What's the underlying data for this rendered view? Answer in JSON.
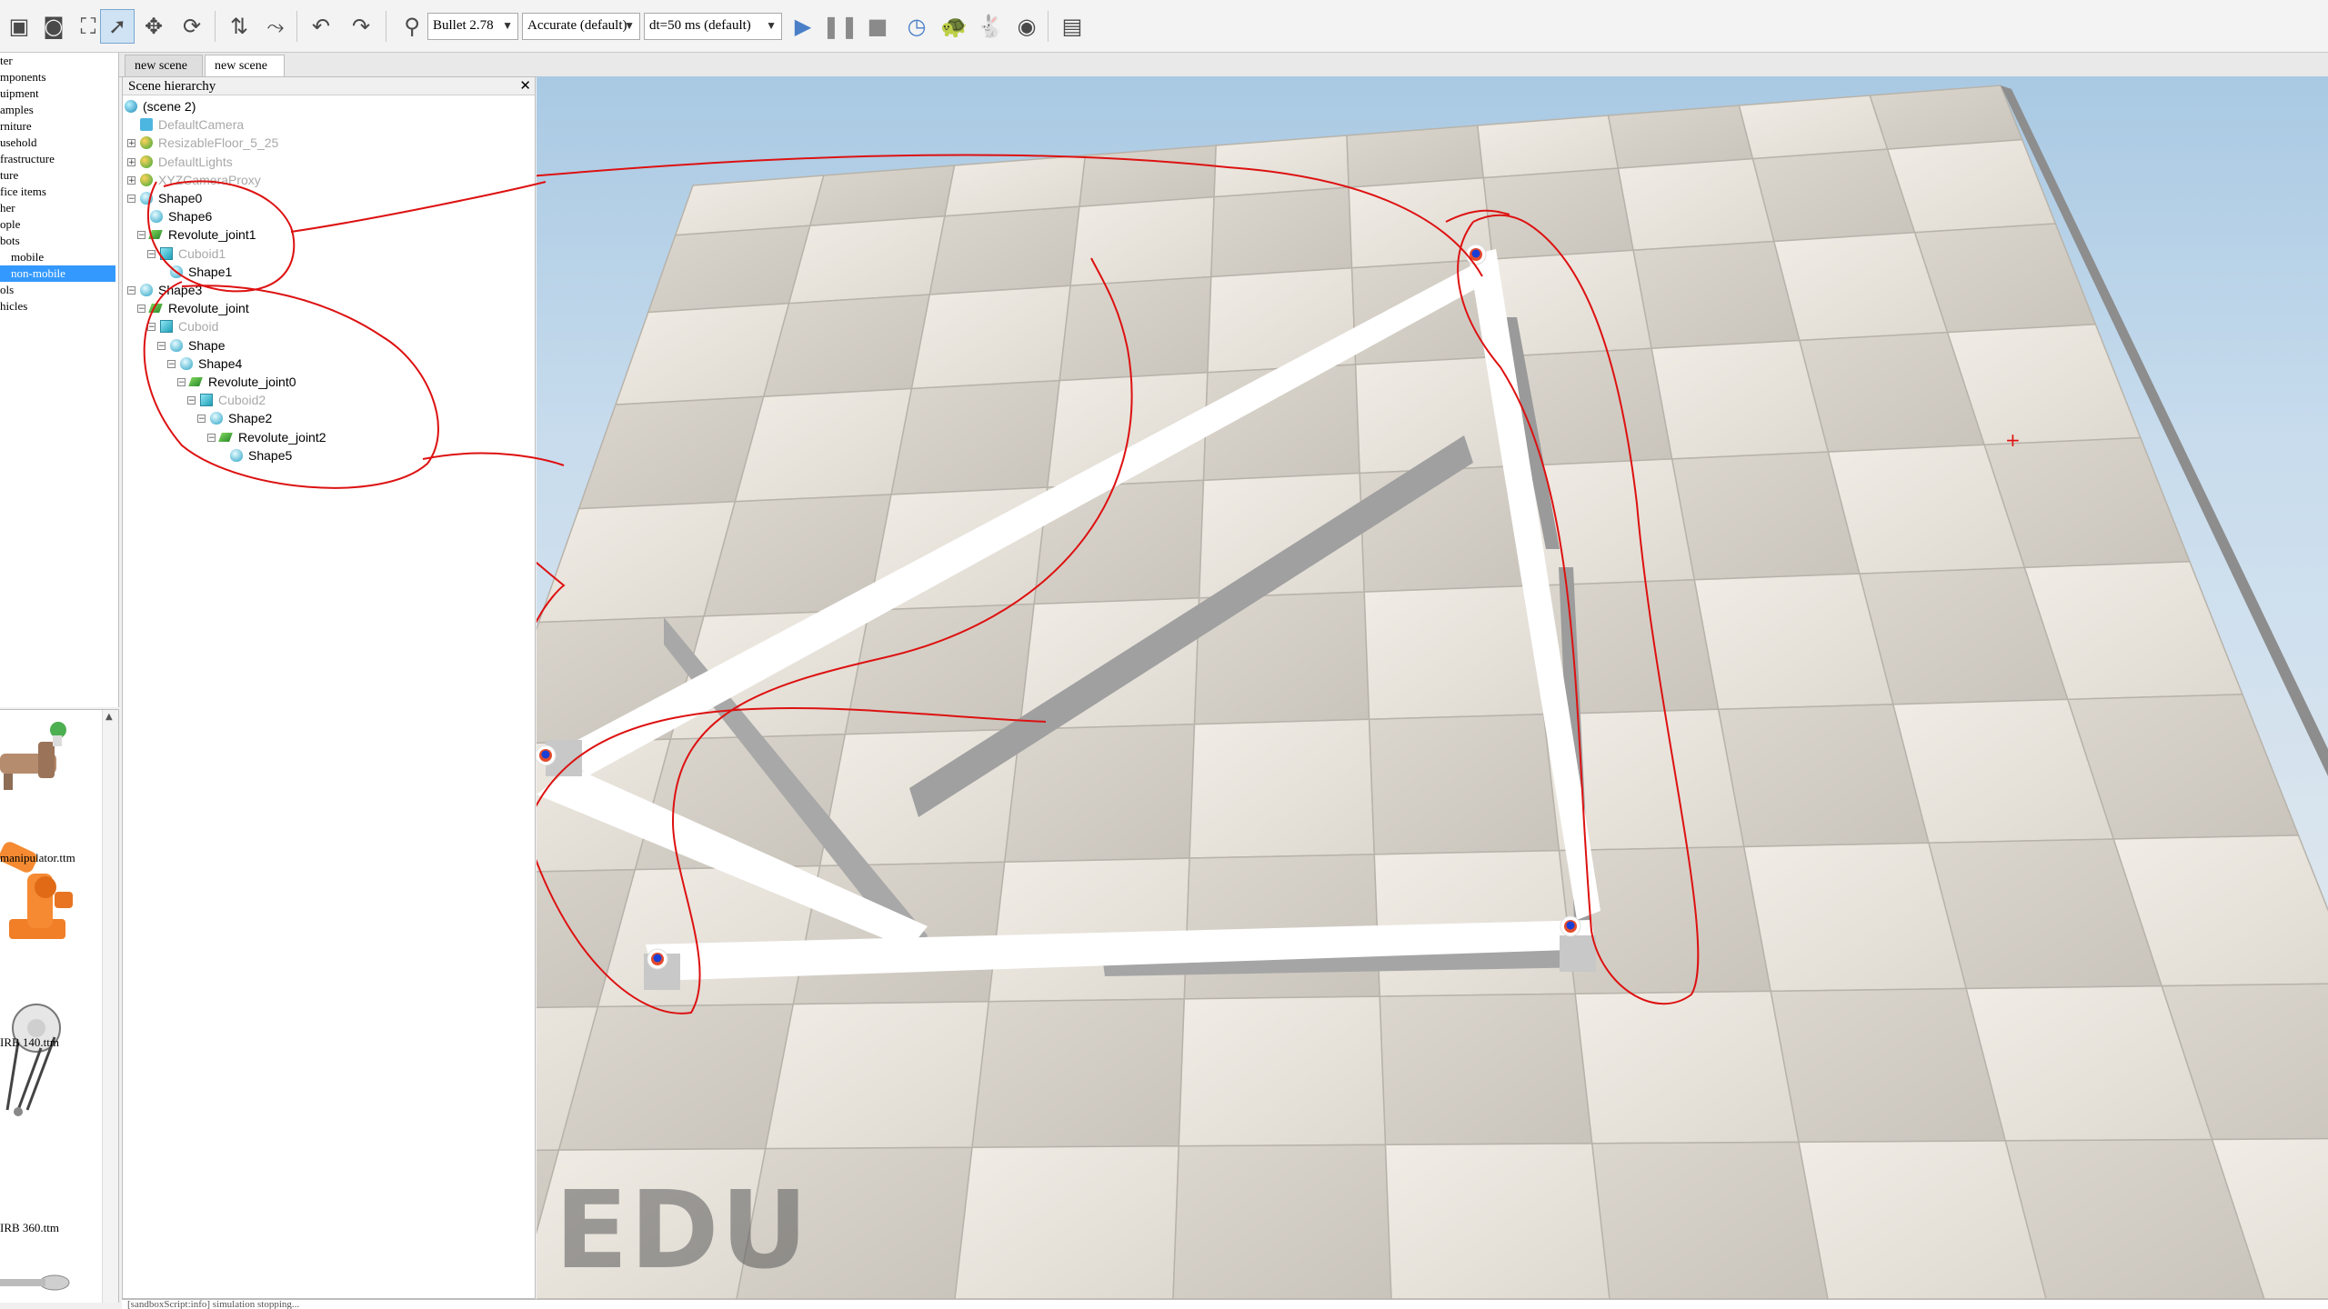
{
  "toolbar": {
    "icons": [
      "camera-icon",
      "screenshot-icon",
      "fit-view-icon",
      "select-cursor-icon",
      "move-icon",
      "rotate-icon",
      "shift-icon",
      "undo-tool-icon",
      "pin-icon",
      "undo-icon",
      "redo-icon",
      "physics-engine-icon",
      "play-icon",
      "pause-icon",
      "stop-icon",
      "realtime-icon",
      "turtle-icon",
      "rabbit-icon",
      "eye-icon",
      "vision-sensor-icon"
    ],
    "engine": "Bullet 2.78",
    "accuracy": "Accurate (default)",
    "timestep": "dt=50 ms (default)",
    "colors": {
      "play": "#4a7fc8",
      "active_bg": "#cfe3f5"
    }
  },
  "model_browser": {
    "items": [
      {
        "label": "ter",
        "selected": false
      },
      {
        "label": "mponents",
        "selected": false
      },
      {
        "label": "uipment",
        "selected": false
      },
      {
        "label": "amples",
        "selected": false
      },
      {
        "label": "rniture",
        "selected": false
      },
      {
        "label": "usehold",
        "selected": false
      },
      {
        "label": "frastructure",
        "selected": false
      },
      {
        "label": "ture",
        "selected": false
      },
      {
        "label": "fice items",
        "selected": false
      },
      {
        "label": "her",
        "selected": false
      },
      {
        "label": "ople",
        "selected": false
      },
      {
        "label": "bots",
        "selected": false
      },
      {
        "label": "mobile",
        "selected": false
      },
      {
        "label": "non-mobile",
        "selected": true
      },
      {
        "label": "ols",
        "selected": false
      },
      {
        "label": "hicles",
        "selected": false
      }
    ],
    "thumbnails": [
      {
        "label": "manipulator.ttm"
      },
      {
        "label": "IRB 140.ttm"
      },
      {
        "label": "IRB 360.ttm"
      }
    ]
  },
  "tabs": [
    {
      "label": "new scene",
      "active": false
    },
    {
      "label": "new scene",
      "active": true
    }
  ],
  "hierarchy": {
    "title": "Scene hierarchy",
    "close": "✕",
    "nodes": [
      {
        "label": "(scene 2)",
        "type": "world",
        "depth": 0,
        "dim": false
      },
      {
        "label": "DefaultCamera",
        "type": "camera",
        "depth": 1,
        "dim": true
      },
      {
        "label": "ResizableFloor_5_25",
        "type": "floor",
        "depth": 1,
        "dim": true
      },
      {
        "label": "DefaultLights",
        "type": "floor",
        "depth": 1,
        "dim": true
      },
      {
        "label": "XYZCameraProxy",
        "type": "floor",
        "depth": 1,
        "dim": true
      },
      {
        "label": "Shape0",
        "type": "shape",
        "depth": 1,
        "dim": false
      },
      {
        "label": "Shape6",
        "type": "shape",
        "depth": 2,
        "dim": false
      },
      {
        "label": "Revolute_joint1",
        "type": "joint",
        "depth": 2,
        "dim": false
      },
      {
        "label": "Cuboid1",
        "type": "cuboid",
        "depth": 3,
        "dim": true
      },
      {
        "label": "Shape1",
        "type": "shape",
        "depth": 4,
        "dim": false
      },
      {
        "label": "Shape3",
        "type": "shape",
        "depth": 1,
        "dim": false
      },
      {
        "label": "Revolute_joint",
        "type": "joint",
        "depth": 2,
        "dim": false
      },
      {
        "label": "Cuboid",
        "type": "cuboid",
        "depth": 3,
        "dim": true
      },
      {
        "label": "Shape",
        "type": "shape",
        "depth": 4,
        "dim": false
      },
      {
        "label": "Shape4",
        "type": "shape",
        "depth": 5,
        "dim": false
      },
      {
        "label": "Revolute_joint0",
        "type": "joint",
        "depth": 6,
        "dim": false
      },
      {
        "label": "Cuboid2",
        "type": "cuboid",
        "depth": 7,
        "dim": true
      },
      {
        "label": "Shape2",
        "type": "shape",
        "depth": 8,
        "dim": false
      },
      {
        "label": "Revolute_joint2",
        "type": "joint",
        "depth": 9,
        "dim": false
      },
      {
        "label": "Shape5",
        "type": "shape",
        "depth": 10,
        "dim": false
      }
    ]
  },
  "viewport": {
    "watermark": "EDU",
    "annotation_color": "#dd1111",
    "floor_colors": [
      "#efebe4",
      "#d9d5ce"
    ],
    "frame_color": "#ffffff",
    "joint_color": "#1a3fd6"
  },
  "statusbar": {
    "text": "[sandboxScript:info] simulation stopping..."
  }
}
